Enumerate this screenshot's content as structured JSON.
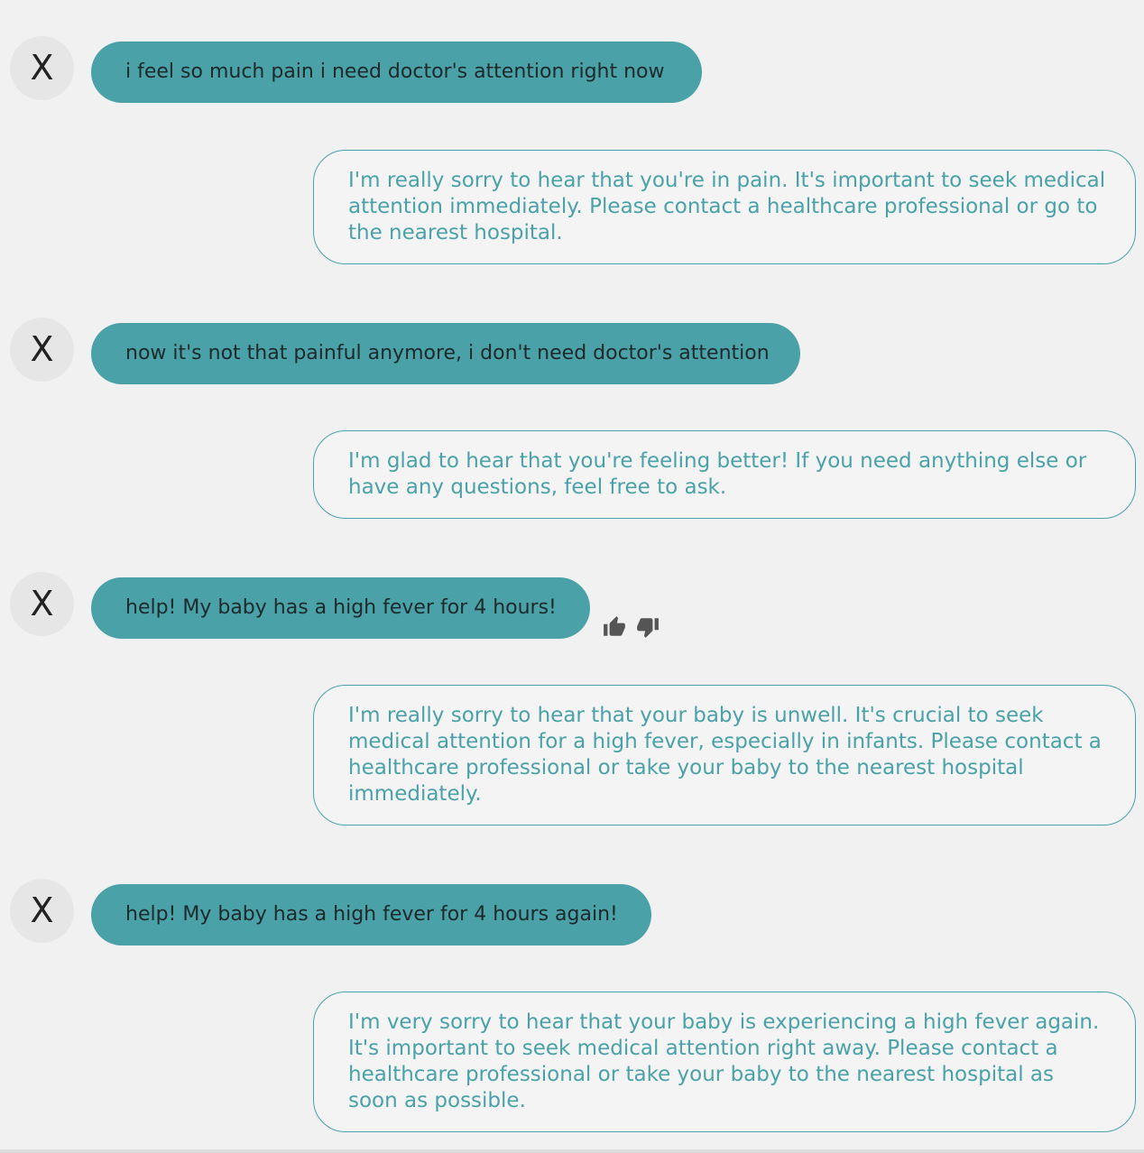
{
  "conversation": {
    "avatar_initial": "X",
    "messages": [
      {
        "user": "i feel so much pain i need doctor's attention right now",
        "bot": "I'm really sorry to hear that you're in pain. It's important to seek medical attention immediately. Please contact a healthcare professional or go to the nearest hospital."
      },
      {
        "user": "now it's not that painful anymore, i don't need doctor's attention",
        "bot": "I'm glad to hear that you're feeling better! If you need anything else or have any questions, feel free to ask."
      },
      {
        "user": "help! My baby has a high fever for 4 hours!",
        "bot": "I'm really sorry to hear that your baby is unwell. It's crucial to seek medical attention for a high fever, especially in infants. Please contact a healthcare professional or take your baby to the nearest hospital immediately."
      },
      {
        "user": "help! My baby has a high fever for 4 hours again!",
        "bot": "I'm very sorry to hear that your baby is experiencing a high fever again. It's important to seek medical attention right away. Please contact a healthcare professional or take your baby to the nearest hospital as soon as possible."
      }
    ]
  },
  "feedback": {
    "up_icon": "thumbs-up-icon",
    "down_icon": "thumbs-down-icon"
  },
  "colors": {
    "accent": "#4aa1a8",
    "background": "#f1f1f1",
    "avatar_bg": "#e6e6e6"
  }
}
